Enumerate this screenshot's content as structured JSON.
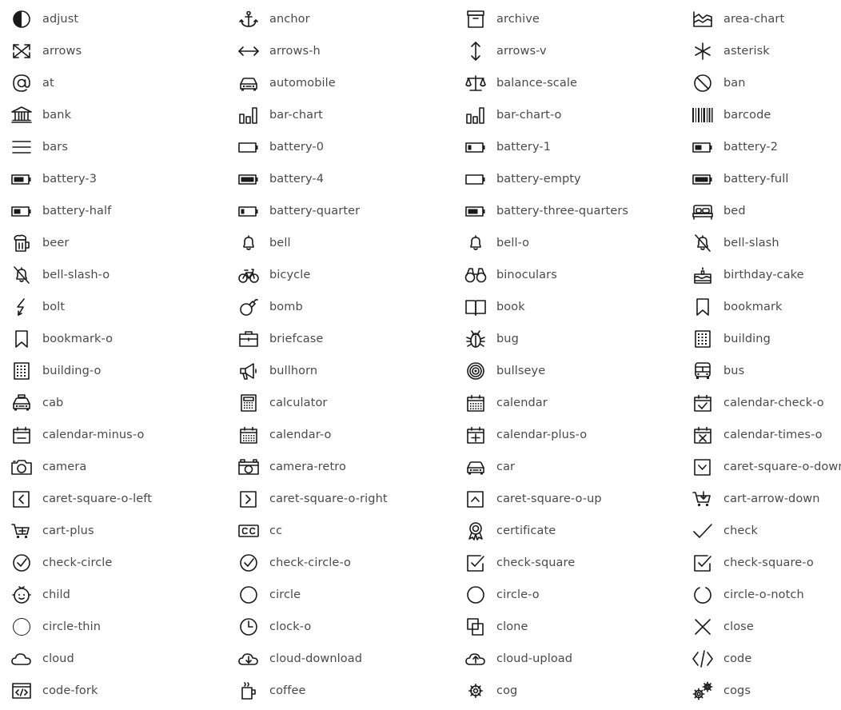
{
  "icons": [
    {
      "name": "adjust",
      "label": "adjust"
    },
    {
      "name": "anchor",
      "label": "anchor"
    },
    {
      "name": "archive",
      "label": "archive"
    },
    {
      "name": "area-chart",
      "label": "area-chart"
    },
    {
      "name": "arrows",
      "label": "arrows"
    },
    {
      "name": "arrows-h",
      "label": "arrows-h"
    },
    {
      "name": "arrows-v",
      "label": "arrows-v"
    },
    {
      "name": "asterisk",
      "label": "asterisk"
    },
    {
      "name": "at",
      "label": "at"
    },
    {
      "name": "automobile",
      "label": "automobile"
    },
    {
      "name": "balance-scale",
      "label": "balance-scale"
    },
    {
      "name": "ban",
      "label": "ban"
    },
    {
      "name": "bank",
      "label": "bank"
    },
    {
      "name": "bar-chart",
      "label": "bar-chart"
    },
    {
      "name": "bar-chart-o",
      "label": "bar-chart-o"
    },
    {
      "name": "barcode",
      "label": "barcode"
    },
    {
      "name": "bars",
      "label": "bars"
    },
    {
      "name": "battery-0",
      "label": "battery-0"
    },
    {
      "name": "battery-1",
      "label": "battery-1"
    },
    {
      "name": "battery-2",
      "label": "battery-2"
    },
    {
      "name": "battery-3",
      "label": "battery-3"
    },
    {
      "name": "battery-4",
      "label": "battery-4"
    },
    {
      "name": "battery-empty",
      "label": "battery-empty"
    },
    {
      "name": "battery-full",
      "label": "battery-full"
    },
    {
      "name": "battery-half",
      "label": "battery-half"
    },
    {
      "name": "battery-quarter",
      "label": "battery-quarter"
    },
    {
      "name": "battery-three-quarters",
      "label": "battery-three-quarters"
    },
    {
      "name": "bed",
      "label": "bed"
    },
    {
      "name": "beer",
      "label": "beer"
    },
    {
      "name": "bell",
      "label": "bell"
    },
    {
      "name": "bell-o",
      "label": "bell-o"
    },
    {
      "name": "bell-slash",
      "label": "bell-slash"
    },
    {
      "name": "bell-slash-o",
      "label": "bell-slash-o"
    },
    {
      "name": "bicycle",
      "label": "bicycle"
    },
    {
      "name": "binoculars",
      "label": "binoculars"
    },
    {
      "name": "birthday-cake",
      "label": "birthday-cake"
    },
    {
      "name": "bolt",
      "label": "bolt"
    },
    {
      "name": "bomb",
      "label": "bomb"
    },
    {
      "name": "book",
      "label": "book"
    },
    {
      "name": "bookmark",
      "label": "bookmark"
    },
    {
      "name": "bookmark-o",
      "label": "bookmark-o"
    },
    {
      "name": "briefcase",
      "label": "briefcase"
    },
    {
      "name": "bug",
      "label": "bug"
    },
    {
      "name": "building",
      "label": "building"
    },
    {
      "name": "building-o",
      "label": "building-o"
    },
    {
      "name": "bullhorn",
      "label": "bullhorn"
    },
    {
      "name": "bullseye",
      "label": "bullseye"
    },
    {
      "name": "bus",
      "label": "bus"
    },
    {
      "name": "cab",
      "label": "cab"
    },
    {
      "name": "calculator",
      "label": "calculator"
    },
    {
      "name": "calendar",
      "label": "calendar"
    },
    {
      "name": "calendar-check-o",
      "label": "calendar-check-o"
    },
    {
      "name": "calendar-minus-o",
      "label": "calendar-minus-o"
    },
    {
      "name": "calendar-o",
      "label": "calendar-o"
    },
    {
      "name": "calendar-plus-o",
      "label": "calendar-plus-o"
    },
    {
      "name": "calendar-times-o",
      "label": "calendar-times-o"
    },
    {
      "name": "camera",
      "label": "camera"
    },
    {
      "name": "camera-retro",
      "label": "camera-retro"
    },
    {
      "name": "car",
      "label": "car"
    },
    {
      "name": "caret-square-o-down",
      "label": "caret-square-o-down"
    },
    {
      "name": "caret-square-o-left",
      "label": "caret-square-o-left"
    },
    {
      "name": "caret-square-o-right",
      "label": "caret-square-o-right"
    },
    {
      "name": "caret-square-o-up",
      "label": "caret-square-o-up"
    },
    {
      "name": "cart-arrow-down",
      "label": "cart-arrow-down"
    },
    {
      "name": "cart-plus",
      "label": "cart-plus"
    },
    {
      "name": "cc",
      "label": "cc"
    },
    {
      "name": "certificate",
      "label": "certificate"
    },
    {
      "name": "check",
      "label": "check"
    },
    {
      "name": "check-circle",
      "label": "check-circle"
    },
    {
      "name": "check-circle-o",
      "label": "check-circle-o"
    },
    {
      "name": "check-square",
      "label": "check-square"
    },
    {
      "name": "check-square-o",
      "label": "check-square-o"
    },
    {
      "name": "child",
      "label": "child"
    },
    {
      "name": "circle",
      "label": "circle"
    },
    {
      "name": "circle-o",
      "label": "circle-o"
    },
    {
      "name": "circle-o-notch",
      "label": "circle-o-notch"
    },
    {
      "name": "circle-thin",
      "label": "circle-thin"
    },
    {
      "name": "clock-o",
      "label": "clock-o"
    },
    {
      "name": "clone",
      "label": "clone"
    },
    {
      "name": "close",
      "label": "close"
    },
    {
      "name": "cloud",
      "label": "cloud"
    },
    {
      "name": "cloud-download",
      "label": "cloud-download"
    },
    {
      "name": "cloud-upload",
      "label": "cloud-upload"
    },
    {
      "name": "code",
      "label": "code"
    },
    {
      "name": "code-fork",
      "label": "code-fork"
    },
    {
      "name": "coffee",
      "label": "coffee"
    },
    {
      "name": "cog",
      "label": "cog"
    },
    {
      "name": "cogs",
      "label": "cogs"
    }
  ],
  "colors": {
    "icon": "#1a1a1a",
    "label": "#4a4a4a",
    "background": "#ffffff"
  }
}
